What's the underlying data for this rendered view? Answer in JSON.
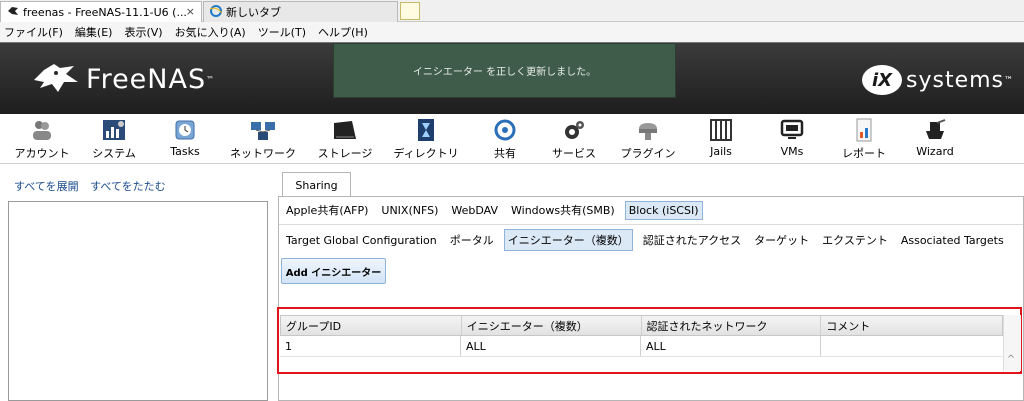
{
  "browser": {
    "tabs": [
      {
        "title": "freenas - FreeNAS-11.1-U6 (...",
        "active": true
      },
      {
        "title": "新しいタブ",
        "active": false
      }
    ],
    "close_glyph": "×"
  },
  "menubar": [
    "ファイル(F)",
    "編集(E)",
    "表示(V)",
    "お気に入り(A)",
    "ツール(T)",
    "ヘルプ(H)"
  ],
  "header": {
    "logo_text": "FreeNAS",
    "logo_tm": "™",
    "notification": "イニシエーター を正しく更新しました。",
    "vendor_mark": "iX",
    "vendor_text": "systems",
    "vendor_tm": "™"
  },
  "toolbar": [
    {
      "label": "アカウント",
      "icon": "users-icon"
    },
    {
      "label": "システム",
      "icon": "system-icon"
    },
    {
      "label": "Tasks",
      "icon": "tasks-icon"
    },
    {
      "label": "ネットワーク",
      "icon": "network-icon"
    },
    {
      "label": "ストレージ",
      "icon": "storage-icon"
    },
    {
      "label": "ディレクトリ",
      "icon": "directory-icon"
    },
    {
      "label": "共有",
      "icon": "sharing-icon"
    },
    {
      "label": "サービス",
      "icon": "services-icon"
    },
    {
      "label": "プラグイン",
      "icon": "plugins-icon"
    },
    {
      "label": "Jails",
      "icon": "jails-icon"
    },
    {
      "label": "VMs",
      "icon": "vms-icon"
    },
    {
      "label": "レポート",
      "icon": "reports-icon"
    },
    {
      "label": "Wizard",
      "icon": "wizard-icon"
    }
  ],
  "left": {
    "expand_all": "すべてを展開",
    "collapse_all": "すべてをたたむ"
  },
  "main": {
    "top_tab": "Sharing",
    "share_types": [
      {
        "label": "Apple共有(AFP)",
        "selected": false
      },
      {
        "label": "UNIX(NFS)",
        "selected": false
      },
      {
        "label": "WebDAV",
        "selected": false
      },
      {
        "label": "Windows共有(SMB)",
        "selected": false
      },
      {
        "label": "Block (iSCSI)",
        "selected": true
      }
    ],
    "iscsi_tabs": [
      {
        "label": "Target Global Configuration",
        "selected": false
      },
      {
        "label": "ポータル",
        "selected": false
      },
      {
        "label": "イニシエーター（複数）",
        "selected": true
      },
      {
        "label": "認証されたアクセス",
        "selected": false
      },
      {
        "label": "ターゲット",
        "selected": false
      },
      {
        "label": "エクステント",
        "selected": false
      },
      {
        "label": "Associated Targets",
        "selected": false
      }
    ],
    "add_button": "Add イニシエーター",
    "table": {
      "columns": [
        "グループID",
        "イニシエーター（複数）",
        "認証されたネットワーク",
        "コメント"
      ],
      "rows": [
        [
          "1",
          "ALL",
          "ALL",
          ""
        ]
      ]
    },
    "scroll_glyph": "^"
  },
  "colors": {
    "header_bg": "#2b2b2b",
    "notification_bg": "#3f5b49",
    "highlight_border": "#e0141b",
    "link": "#1a4b8c",
    "selected_tab": "#dbe8f6"
  }
}
